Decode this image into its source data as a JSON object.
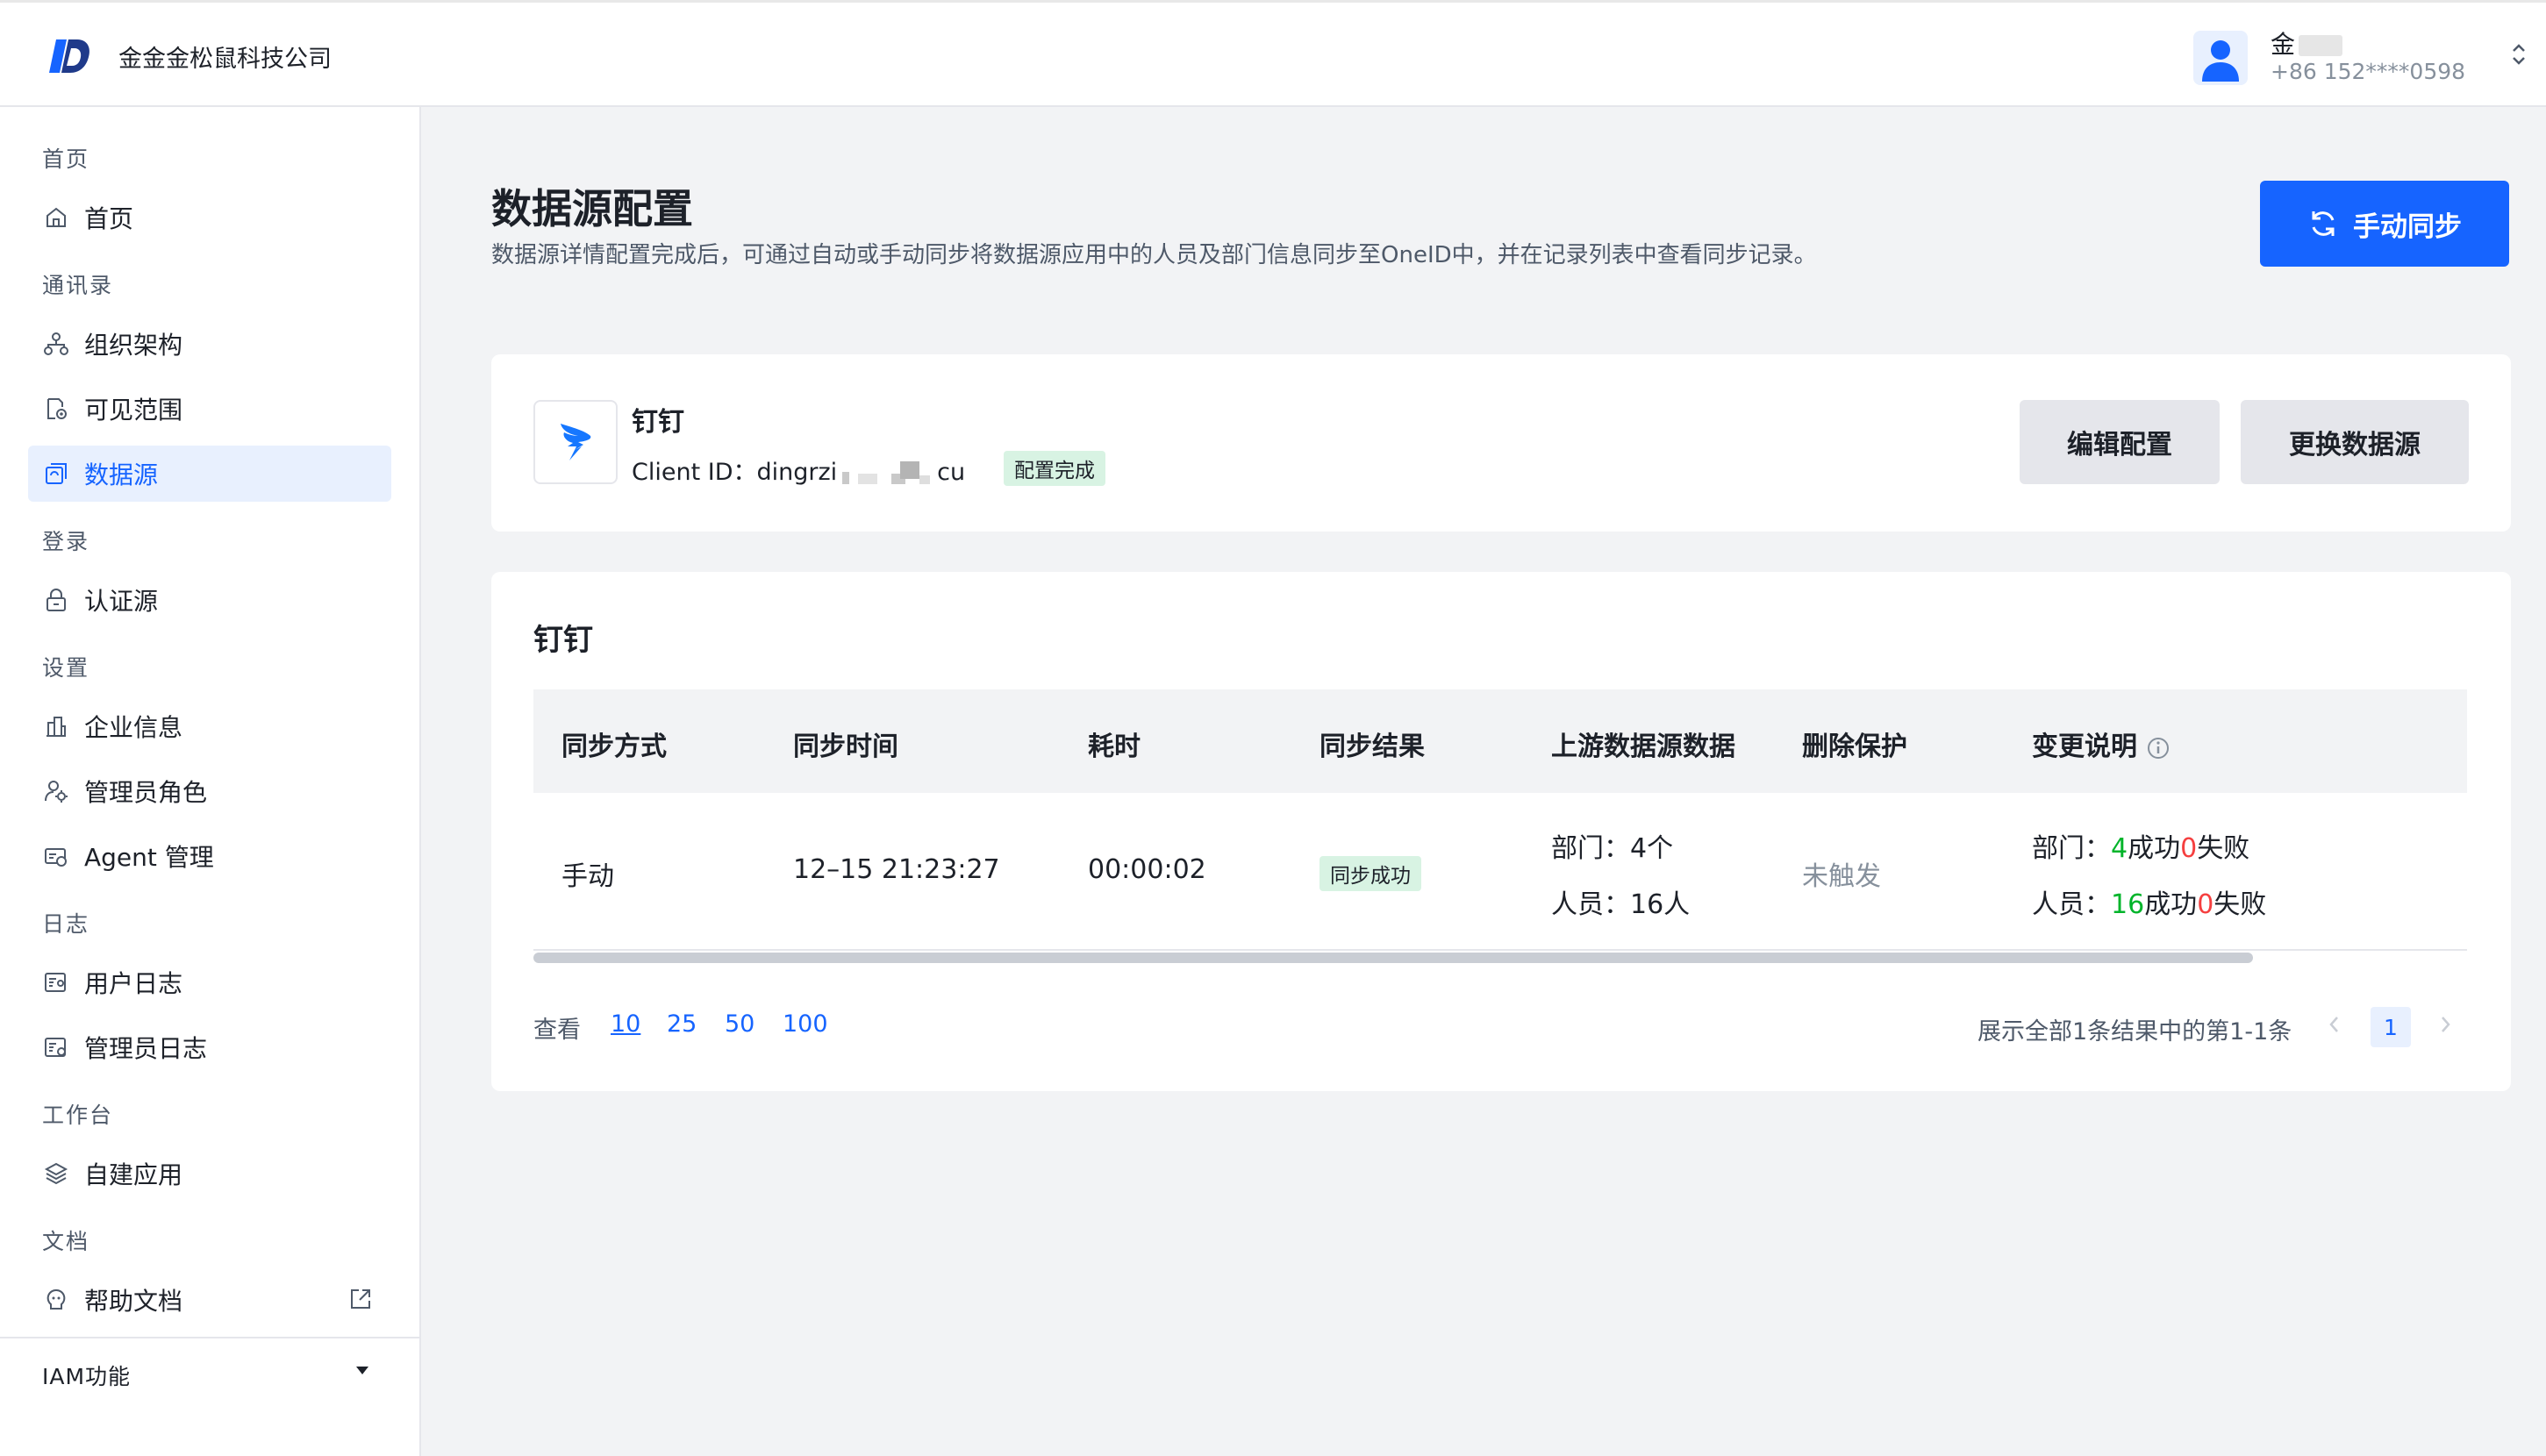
{
  "header": {
    "company": "金金金松鼠科技公司",
    "user_name": "金",
    "user_phone": "+86 152****0598"
  },
  "sidebar": {
    "groups": [
      "首页",
      "通讯录",
      "登录",
      "设置",
      "日志",
      "工作台",
      "文档"
    ],
    "items": [
      {
        "label": "首页",
        "icon": "home-icon"
      },
      {
        "label": "组织架构",
        "icon": "org-structure-icon"
      },
      {
        "label": "可见范围",
        "icon": "visibility-scope-icon"
      },
      {
        "label": "数据源",
        "icon": "data-source-icon",
        "active": true
      },
      {
        "label": "认证源",
        "icon": "lock-icon"
      },
      {
        "label": "企业信息",
        "icon": "building-icon"
      },
      {
        "label": "管理员角色",
        "icon": "admin-role-icon"
      },
      {
        "label": "Agent 管理",
        "icon": "agent-icon"
      },
      {
        "label": "用户日志",
        "icon": "user-log-icon"
      },
      {
        "label": "管理员日志",
        "icon": "admin-log-icon"
      },
      {
        "label": "自建应用",
        "icon": "layers-icon"
      },
      {
        "label": "帮助文档",
        "icon": "help-icon"
      }
    ],
    "footer": "IAM功能"
  },
  "main": {
    "title": "数据源配置",
    "description": "数据源详情配置完成后，可通过自动或手动同步将数据源应用中的人员及部门信息同步至OneID中，并在记录列表中查看同步记录。",
    "sync_button": "手动同步"
  },
  "source": {
    "name": "钉钉",
    "client_prefix": "Client ID：dingrzi",
    "client_suffix": "cu",
    "status": "配置完成",
    "edit_button": "编辑配置",
    "change_button": "更换数据源"
  },
  "records": {
    "title": "钉钉",
    "columns": [
      "同步方式",
      "同步时间",
      "耗时",
      "同步结果",
      "上游数据源数据",
      "删除保护",
      "变更说明"
    ],
    "row": {
      "method": "手动",
      "time": "12–15 21:23:27",
      "duration": "00:00:02",
      "result": "同步成功",
      "upstream_dept": "部门：4个",
      "upstream_user": "人员：16人",
      "protection": "未触发",
      "change_dept_label": "部门：",
      "change_dept_success": "4",
      "change_dept_success_text": "成功",
      "change_dept_fail": "0",
      "change_dept_fail_text": "失败",
      "change_user_label": "人员：",
      "change_user_success": "16",
      "change_user_success_text": "成功",
      "change_user_fail": "0",
      "change_user_fail_text": "失败"
    }
  },
  "pagination": {
    "view_label": "查看",
    "sizes": [
      "10",
      "25",
      "50",
      "100"
    ],
    "selected_size": "10",
    "summary": "展示全部1条结果中的第1-1条",
    "current_page": "1"
  },
  "colors": {
    "primary": "#1664ff",
    "success": "#00b42a",
    "danger": "#f53f3f",
    "badge_bg": "#d8f3e3"
  }
}
